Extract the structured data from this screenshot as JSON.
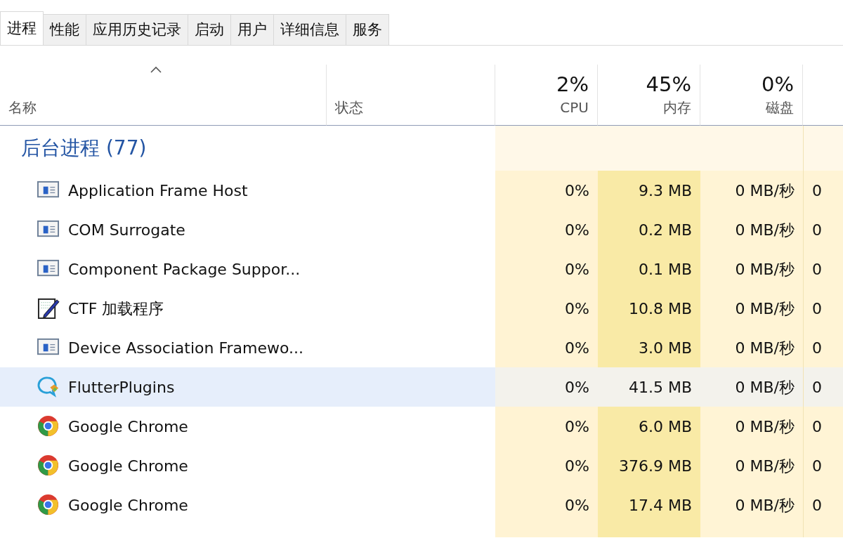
{
  "tabs": [
    {
      "label": "进程",
      "selected": true
    },
    {
      "label": "性能",
      "selected": false
    },
    {
      "label": "应用历史记录",
      "selected": false
    },
    {
      "label": "启动",
      "selected": false
    },
    {
      "label": "用户",
      "selected": false
    },
    {
      "label": "详细信息",
      "selected": false
    },
    {
      "label": "服务",
      "selected": false
    }
  ],
  "columns": [
    {
      "label": "名称",
      "sorted": true
    },
    {
      "label": "状态"
    },
    {
      "usage": "2%",
      "label": "CPU"
    },
    {
      "usage": "45%",
      "label": "内存"
    },
    {
      "usage": "0%",
      "label": "磁盘"
    }
  ],
  "group": {
    "title": "后台进程 (77)"
  },
  "rows": [
    {
      "kind": "window",
      "name": "Application Frame Host",
      "cpu": "0%",
      "memory": "9.3 MB",
      "disk": "0 MB/秒",
      "column_5": "0",
      "selected": false
    },
    {
      "kind": "window",
      "name": "COM Surrogate",
      "cpu": "0%",
      "memory": "0.2 MB",
      "disk": "0 MB/秒",
      "column_5": "0",
      "selected": false
    },
    {
      "kind": "window",
      "name": "Component Package Suppor...",
      "cpu": "0%",
      "memory": "0.1 MB",
      "disk": "0 MB/秒",
      "column_5": "0",
      "selected": false
    },
    {
      "kind": "notepad",
      "name": "CTF 加载程序",
      "cpu": "0%",
      "memory": "10.8 MB",
      "disk": "0 MB/秒",
      "column_5": "0",
      "selected": false
    },
    {
      "kind": "window",
      "name": "Device Association Framewo...",
      "cpu": "0%",
      "memory": "3.0 MB",
      "disk": "0 MB/秒",
      "column_5": "0",
      "selected": false
    },
    {
      "kind": "bubble",
      "name": "FlutterPlugins",
      "cpu": "0%",
      "memory": "41.5 MB",
      "disk": "0 MB/秒",
      "column_5": "0",
      "selected": true
    },
    {
      "kind": "chrome",
      "name": "Google Chrome",
      "cpu": "0%",
      "memory": "6.0 MB",
      "disk": "0 MB/秒",
      "column_5": "0",
      "selected": false
    },
    {
      "kind": "chrome",
      "name": "Google Chrome",
      "cpu": "0%",
      "memory": "376.9 MB",
      "disk": "0 MB/秒",
      "column_5": "0",
      "selected": false
    },
    {
      "kind": "chrome",
      "name": "Google Chrome",
      "cpu": "0%",
      "memory": "17.4 MB",
      "disk": "0 MB/秒",
      "column_5": "0",
      "selected": false
    }
  ]
}
